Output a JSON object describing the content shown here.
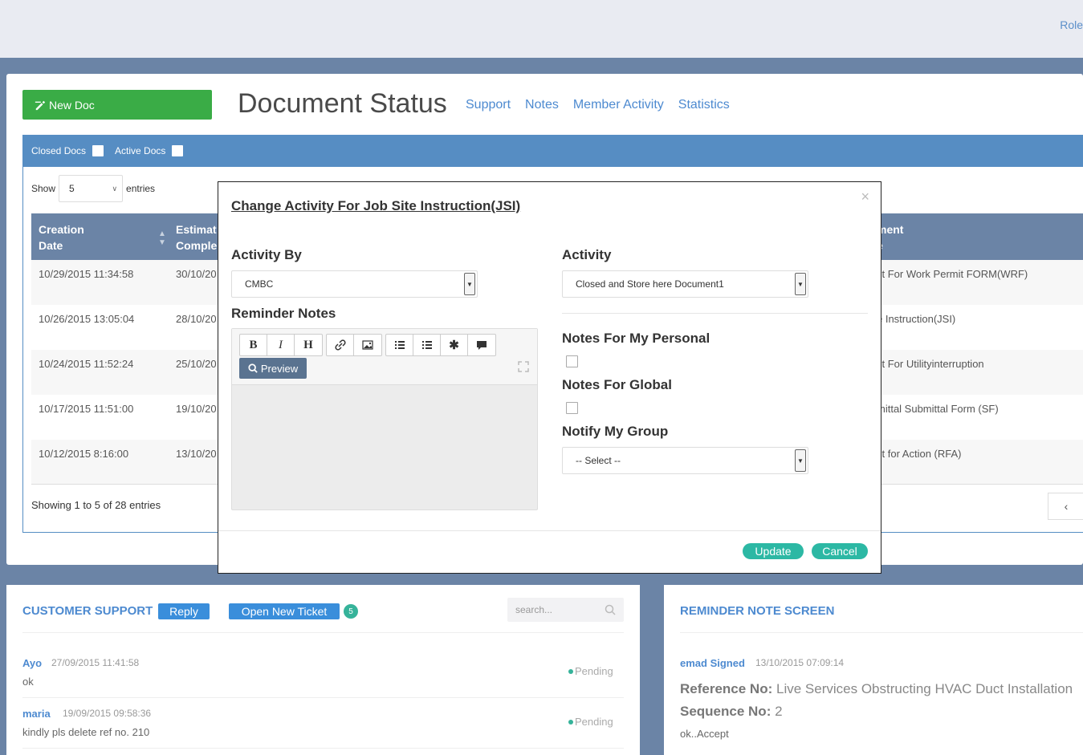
{
  "topbar": {
    "role_link": "Role"
  },
  "main": {
    "new_doc_label": "New Doc",
    "page_title": "Document Status",
    "nav_links": [
      "Support",
      "Notes",
      "Member Activity",
      "Statistics"
    ],
    "filters": {
      "closed_docs": "Closed Docs",
      "active_docs": "Active Docs"
    },
    "show_label": "Show",
    "entries_value": "5",
    "entries_label": "entries",
    "table": {
      "col1": [
        "Creation",
        "Date"
      ],
      "col2": [
        "Estimat",
        "Comple"
      ],
      "col3": [
        "ment",
        "e"
      ],
      "rows": [
        {
          "created": "10/29/2015 11:34:58",
          "est": "30/10/20",
          "doc": "st For Work Permit FORM(WRF)"
        },
        {
          "created": "10/26/2015 13:05:04",
          "est": "28/10/20",
          "doc": "e Instruction(JSI)"
        },
        {
          "created": "10/24/2015 11:52:24",
          "est": "25/10/20",
          "doc": "st For Utilityinterruption"
        },
        {
          "created": "10/17/2015 11:51:00",
          "est": "19/10/20",
          "doc": "mittal Submittal Form (SF)"
        },
        {
          "created": "10/12/2015 8:16:00",
          "est": "13/10/20",
          "doc": "st for Action (RFA)"
        }
      ],
      "footer": "Showing 1 to 5 of 28 entries",
      "pager_prev": "‹"
    }
  },
  "modal": {
    "title": "Change Activity For Job Site Instruction(JSI)",
    "close": "×",
    "activity_by_label": "Activity By",
    "activity_by_value": "CMBC",
    "activity_label": "Activity",
    "activity_value": "Closed and Store here Document1",
    "reminder_notes_label": "Reminder Notes",
    "preview_label": "Preview",
    "notes_personal_label": "Notes For My Personal",
    "notes_global_label": "Notes For Global",
    "notify_group_label": "Notify My Group",
    "notify_group_value": "-- Select --",
    "update_label": "Update",
    "cancel_label": "Cancel"
  },
  "support": {
    "heading": "CUSTOMER SUPPORT",
    "reply_label": "Reply",
    "open_ticket_label": "Open New Ticket",
    "ticket_count": "5",
    "search_placeholder": "search...",
    "messages": [
      {
        "name": "Ayo",
        "time": "27/09/2015 11:41:58",
        "text": "ok",
        "status": "Pending"
      },
      {
        "name": "maria",
        "time": "19/09/2015 09:58:36",
        "text": "kindly pls delete ref no. 210",
        "status": "Pending"
      }
    ]
  },
  "reminder": {
    "heading": "REMINDER NOTE SCREEN",
    "name": "emad Signed",
    "time": "13/10/2015 07:09:14",
    "ref_label": "Reference No:",
    "ref_value": "Live Services Obstructing HVAC Duct Installation",
    "seq_label": "Sequence No:",
    "seq_value": "2",
    "note": "ok..Accept"
  },
  "colors": {
    "accent": "#4d8ad0",
    "green": "#3aac46",
    "teal": "#2cb8a4",
    "bar": "#568dc3",
    "backdrop": "#6b84a6"
  }
}
